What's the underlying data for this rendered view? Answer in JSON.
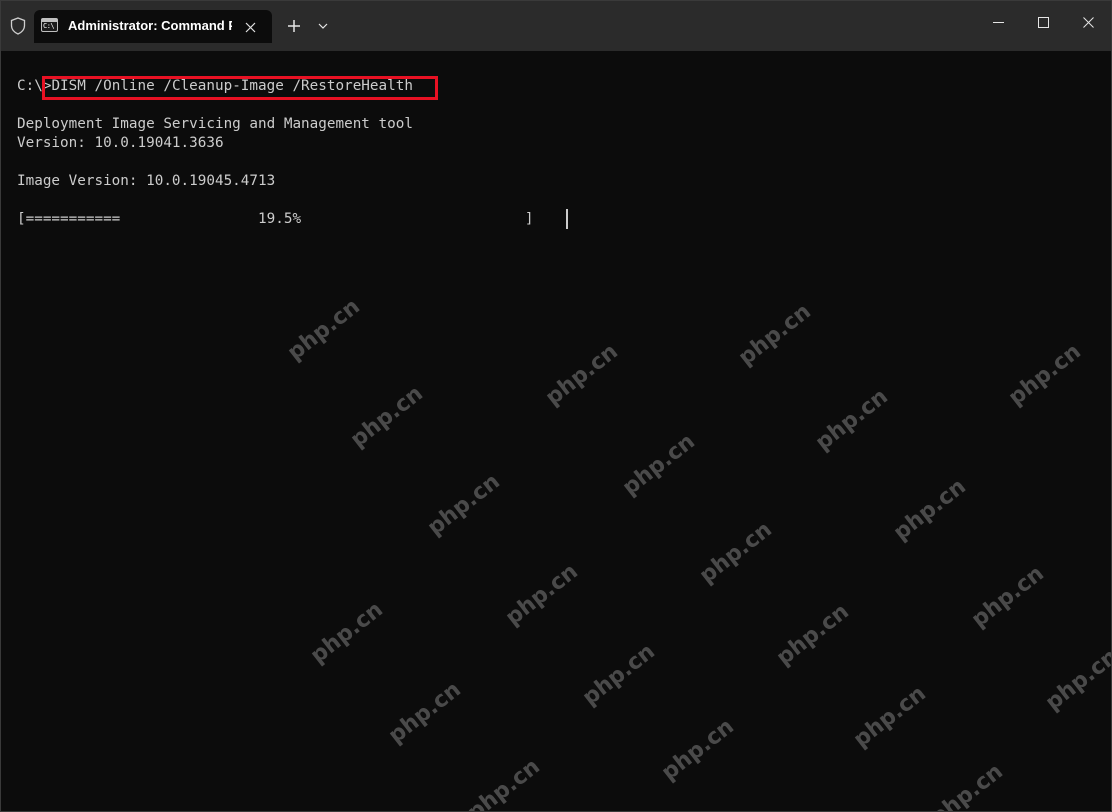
{
  "window": {
    "tab_title": "Administrator: Command Prompt",
    "tab_icon_text": "C:\\"
  },
  "icons": {
    "shield": "shield-icon",
    "tab": "cmd-icon",
    "close_tab": "close-icon",
    "new_tab": "plus-icon",
    "dropdown": "chevron-down-icon",
    "minimize": "minimize-icon",
    "maximize": "maximize-icon",
    "close": "close-icon"
  },
  "colors": {
    "background": "#0c0c0c",
    "titlebar": "#2b2b2b",
    "text": "#cccccc",
    "highlight": "#e81123"
  },
  "console": {
    "prompt": "C:\\>",
    "command": "DISM /Online /Cleanup-Image /RestoreHealth",
    "tool_line": "Deployment Image Servicing and Management tool",
    "version_line": "Version: 10.0.19041.3636",
    "image_version_line": "Image Version: 10.0.19045.4713",
    "progress_line": "[===========                19.5%                          ]",
    "progress_percent": 19.5
  },
  "watermark": "php.cn"
}
